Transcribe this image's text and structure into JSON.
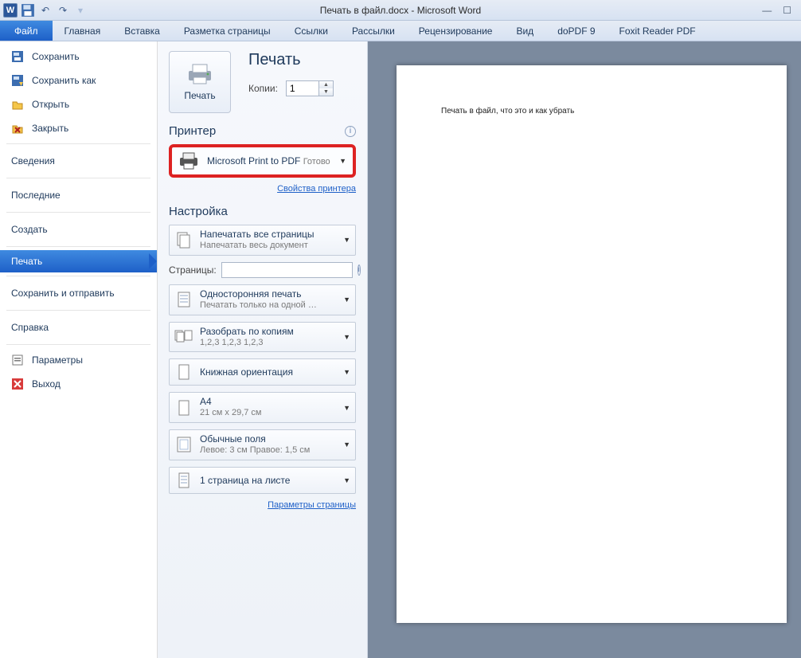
{
  "titlebar": {
    "app_icon_letter": "W",
    "title": "Печать в файл.docx - Microsoft Word"
  },
  "ribbon": {
    "file": "Файл",
    "tabs": [
      "Главная",
      "Вставка",
      "Разметка страницы",
      "Ссылки",
      "Рассылки",
      "Рецензирование",
      "Вид",
      "doPDF 9",
      "Foxit Reader PDF"
    ]
  },
  "sidebar": {
    "items_top": [
      {
        "label": "Сохранить",
        "icon": "save-icon"
      },
      {
        "label": "Сохранить как",
        "icon": "save-as-icon"
      },
      {
        "label": "Открыть",
        "icon": "open-icon"
      },
      {
        "label": "Закрыть",
        "icon": "close-folder-icon"
      }
    ],
    "groups": [
      "Сведения",
      "Последние",
      "Создать"
    ],
    "selected": "Печать",
    "after": [
      "Сохранить и отправить",
      "Справка"
    ],
    "items_bottom": [
      {
        "label": "Параметры",
        "icon": "options-icon"
      },
      {
        "label": "Выход",
        "icon": "exit-icon"
      }
    ]
  },
  "print": {
    "heading": "Печать",
    "copies_label": "Копии:",
    "copies_value": "1",
    "button_label": "Печать"
  },
  "printer": {
    "heading": "Принтер",
    "name": "Microsoft Print to PDF",
    "status": "Готово",
    "properties_link": "Свойства принтера"
  },
  "settings": {
    "heading": "Настройка",
    "print_all": {
      "title": "Напечатать все страницы",
      "sub": "Напечатать весь документ"
    },
    "pages_label": "Страницы:",
    "pages_value": "",
    "one_sided": {
      "title": "Односторонняя печать",
      "sub": "Печатать только на одной …"
    },
    "collate": {
      "title": "Разобрать по копиям",
      "sub": "1,2,3    1,2,3    1,2,3"
    },
    "orientation": {
      "title": "Книжная ориентация"
    },
    "paper": {
      "title": "A4",
      "sub": "21 см x 29,7 см"
    },
    "margins": {
      "title": "Обычные поля",
      "sub": "Левое:  3 см   Правое:  1,5 см"
    },
    "per_sheet": {
      "title": "1 страница на листе"
    },
    "page_setup_link": "Параметры страницы"
  },
  "preview": {
    "text": "Печать в файл, что это и как убрать"
  }
}
